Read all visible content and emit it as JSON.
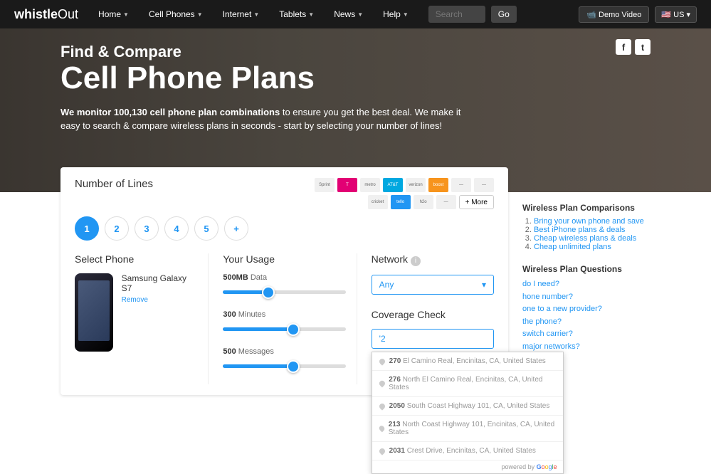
{
  "nav": {
    "logo_bold": "whistle",
    "logo_light": "Out",
    "items": [
      "Home",
      "Cell Phones",
      "Internet",
      "Tablets",
      "News",
      "Help"
    ],
    "search_placeholder": "Search",
    "go": "Go",
    "demo": "Demo Video",
    "locale": "US"
  },
  "hero": {
    "small_title": "Find & Compare",
    "big_title": "Cell Phone Plans",
    "sub_bold": "We monitor 100,130 cell phone plan combinations",
    "sub_rest": " to ensure you get the best deal. We make it easy to search & compare wireless plans in seconds - start by selecting your number of lines!"
  },
  "lines": {
    "label": "Number of Lines",
    "options": [
      "1",
      "2",
      "3",
      "4",
      "5",
      "+"
    ],
    "more": "+ More"
  },
  "carriers": [
    "Sprint",
    "T",
    "metro",
    "AT&T",
    "verizon",
    "boost",
    "—",
    "—",
    "cricket",
    "tello",
    "h2o",
    "—"
  ],
  "selectphone": {
    "title": "Select Phone",
    "name": "Samsung Galaxy S7",
    "remove": "Remove"
  },
  "usage": {
    "title": "Your Usage",
    "data_val": "500MB",
    "data_lbl": "Data",
    "min_val": "300",
    "min_lbl": "Minutes",
    "msg_val": "500",
    "msg_lbl": "Messages"
  },
  "network": {
    "title": "Network",
    "value": "Any"
  },
  "coverage": {
    "title": "Coverage Check",
    "input_value": "'2",
    "suggestions": [
      {
        "num": "270",
        "rest": "El Camino Real, Encinitas, CA, United States"
      },
      {
        "num": "276",
        "rest": "North El Camino Real, Encinitas, CA, United States"
      },
      {
        "num": "2050",
        "rest": "South Coast Highway 101, CA, United States"
      },
      {
        "num": "213",
        "rest": "North Coast Highway 101, Encinitas, CA, United States"
      },
      {
        "num": "2031",
        "rest": "Crest Drive, Encinitas, CA, United States"
      }
    ],
    "powered": "powered by "
  },
  "sidebar": {
    "comparisons_title": "Wireless Plan Comparisons",
    "comparisons": [
      "Bring your own phone and save",
      "Best iPhone plans & deals",
      "Cheap wireless plans & deals",
      "Cheap unlimited plans"
    ],
    "questions_title": "Wireless Plan Questions",
    "questions": [
      "do I need?",
      "hone number?",
      "one to a new provider?",
      "the phone?",
      "switch carrier?",
      "major networks?"
    ]
  }
}
